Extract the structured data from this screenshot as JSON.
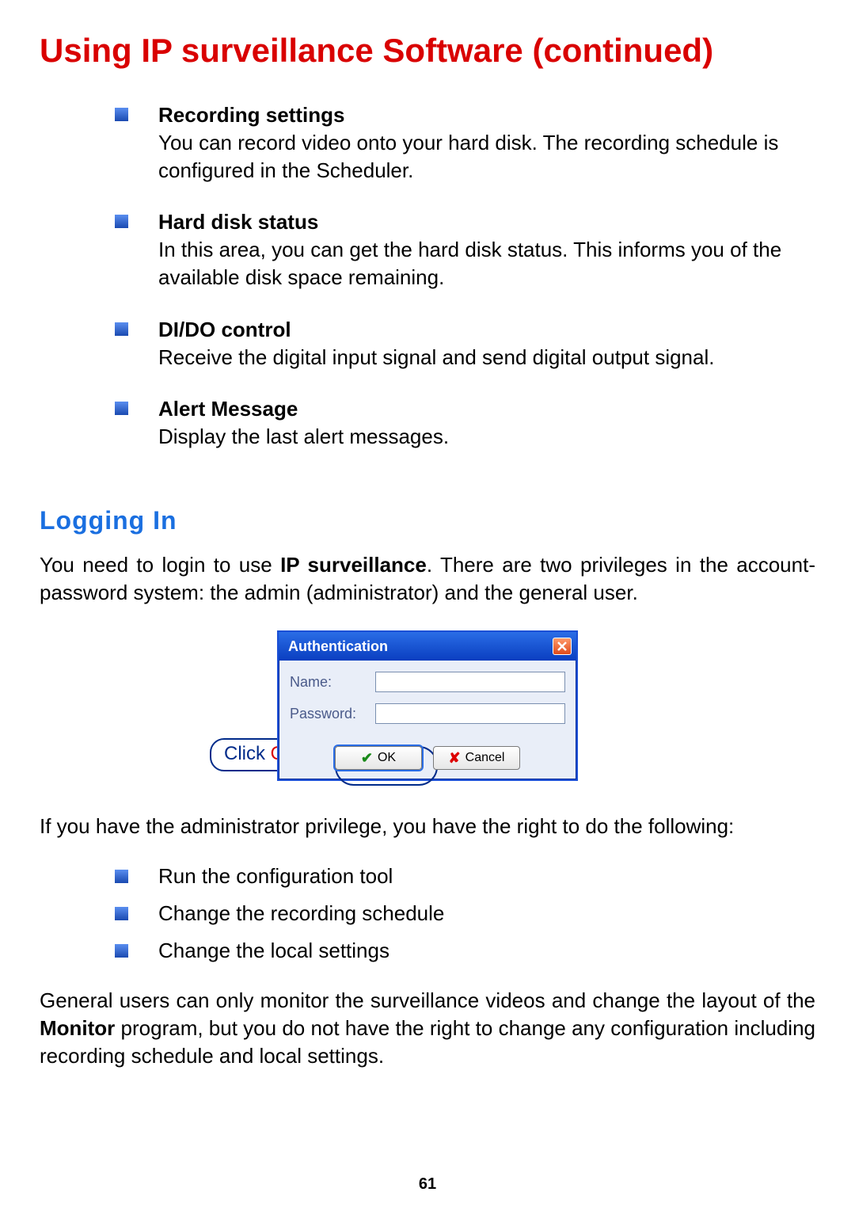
{
  "page_title": "Using IP surveillance Software (continued)",
  "features": [
    {
      "title": "Recording settings",
      "desc": "You can record video onto your hard disk. The recording schedule is configured in the Scheduler."
    },
    {
      "title": "Hard disk status",
      "desc": "In this area, you can get the hard disk status. This informs you of the available disk space remaining."
    },
    {
      "title": "DI/DO control",
      "desc": "Receive the digital input signal and send digital output signal."
    },
    {
      "title": "Alert Message",
      "desc": "Display the last alert messages."
    }
  ],
  "section_heading": "Logging In",
  "intro_pre": "You need to login to use ",
  "intro_bold": "IP surveillance",
  "intro_post": ". There are two privileges in the account-password system: the admin (administrator) and the general user.",
  "dialog": {
    "title": "Authentication",
    "name_label": "Name:",
    "password_label": "Password:",
    "ok_label": "OK",
    "cancel_label": "Cancel"
  },
  "callout_prefix": "Click ",
  "callout_ok": "OK",
  "admin_intro": "If you have the administrator privilege, you have the right to do the following:",
  "privileges": [
    "Run the configuration tool",
    "Change the recording schedule",
    "Change the local settings"
  ],
  "general_pre": "General users can only monitor the surveillance videos and change the layout of the ",
  "general_bold": "Monitor",
  "general_post": " program, but you do not have the right to change any configuration including recording schedule and local settings.",
  "page_number": "61"
}
